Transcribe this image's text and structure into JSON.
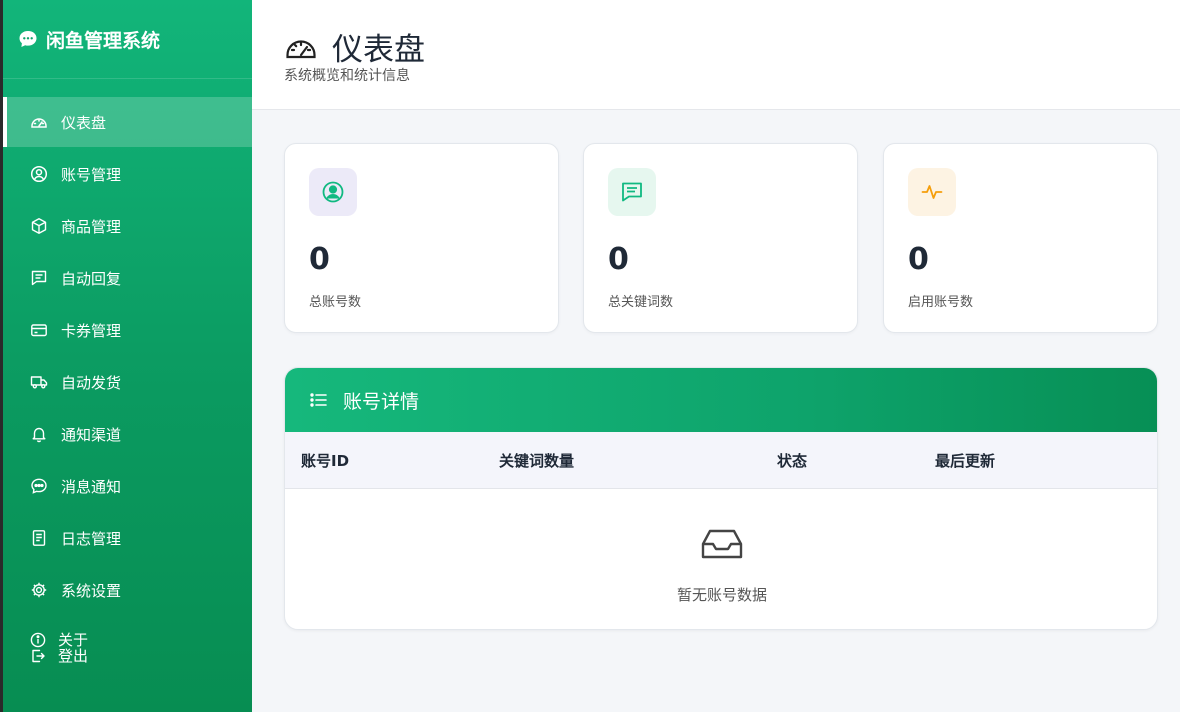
{
  "app": {
    "title": "闲鱼管理系统"
  },
  "sidebar": {
    "items": [
      {
        "label": "仪表盘",
        "icon": "gauge-icon",
        "active": true
      },
      {
        "label": "账号管理",
        "icon": "user-circle-icon"
      },
      {
        "label": "商品管理",
        "icon": "box-icon"
      },
      {
        "label": "自动回复",
        "icon": "message-square-icon"
      },
      {
        "label": "卡券管理",
        "icon": "card-icon"
      },
      {
        "label": "自动发货",
        "icon": "truck-icon"
      },
      {
        "label": "通知渠道",
        "icon": "bell-icon"
      },
      {
        "label": "消息通知",
        "icon": "chat-dots-icon"
      },
      {
        "label": "日志管理",
        "icon": "document-icon"
      },
      {
        "label": "系统设置",
        "icon": "gear-icon"
      }
    ],
    "footer": [
      {
        "label": "关于",
        "icon": "info-icon"
      },
      {
        "label": "登出",
        "icon": "logout-icon"
      }
    ]
  },
  "header": {
    "title": "仪表盘",
    "subtitle": "系统概览和统计信息"
  },
  "stats": [
    {
      "value": "0",
      "label": "总账号数",
      "icon": "user-circle-icon",
      "color": "#10b981",
      "bg": "#eceaf8"
    },
    {
      "value": "0",
      "label": "总关键词数",
      "icon": "chat-lines-icon",
      "color": "#10b981",
      "bg": "#e6f7ef"
    },
    {
      "value": "0",
      "label": "启用账号数",
      "icon": "pulse-icon",
      "color": "#f59e0b",
      "bg": "#fdf3e3"
    }
  ],
  "accounts_table": {
    "title": "账号详情",
    "columns": [
      "账号ID",
      "关键词数量",
      "状态",
      "最后更新"
    ],
    "empty_text": "暂无账号数据"
  },
  "colors": {
    "brand": "#0ea36b",
    "sidebar_top": "#12b57a",
    "sidebar_bottom": "#078d52"
  }
}
